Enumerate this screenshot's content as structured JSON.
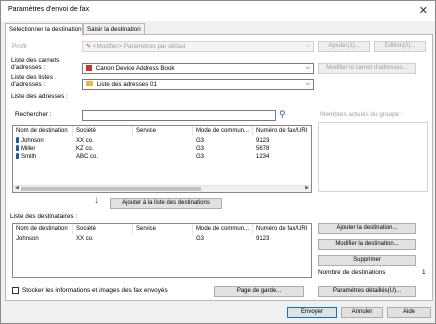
{
  "window": {
    "title": "Paramètres d'envoi de fax"
  },
  "tabs": [
    {
      "label": "Sélectionner la destination"
    },
    {
      "label": "Saisir la destination"
    }
  ],
  "profile": {
    "label": "Profil",
    "value": "<Modifier> Paramètres par défaut",
    "add_button": "Ajouter(1)...",
    "edit_button": "Édition(2)..."
  },
  "address_book": {
    "label": "Liste des carnets d'adresses :",
    "value": "Canon Device Address Book",
    "modify_button": "Modifier le carnet d'adresses..."
  },
  "address_lists": {
    "label": "Liste des listes d'adresses :",
    "value": "Liste des adresses 01"
  },
  "addresses_label": "Liste des adresses :",
  "search": {
    "label": "Rechercher :",
    "value": ""
  },
  "group_members_label": "Membres actuels du groupe :",
  "address_table": {
    "columns": [
      "Nom de destination",
      "Société",
      "Service",
      "Mode de commun...",
      "Numéro de fax/URI"
    ],
    "rows": [
      {
        "name": "Johnson",
        "company": "XX co.",
        "service": "",
        "mode": "G3",
        "number": "9123"
      },
      {
        "name": "Miller",
        "company": "KZ co.",
        "service": "",
        "mode": "G3",
        "number": "5678"
      },
      {
        "name": "Smith",
        "company": "ABC co.",
        "service": "",
        "mode": "G3",
        "number": "1234"
      }
    ]
  },
  "add_to_list_button": "Ajouter à la liste des destinations",
  "recipients": {
    "label": "Liste des destinataires :",
    "columns": [
      "Nom de destination",
      "Société",
      "Service",
      "Mode de commun...",
      "Numéro de fax/URI"
    ],
    "rows": [
      {
        "name": "Johnson",
        "company": "XX co.",
        "service": "",
        "mode": "G3",
        "number": "9123"
      }
    ]
  },
  "side_buttons": {
    "add_destination": "Ajouter la destination...",
    "modify_destination": "Modifier la destination...",
    "delete": "Supprimer"
  },
  "destination_count": {
    "label": "Nombre de destinations",
    "value": "1"
  },
  "store_checkbox": {
    "label": "Stocker les informations et images des fax envoyés",
    "checked": false
  },
  "cover_page_button": "Page de garde...",
  "detail_settings_button": "Paramètres détaillés(U)...",
  "footer": {
    "send": "Envoyer",
    "cancel": "Annuler",
    "help": "Aide"
  },
  "colors": {
    "accent": "#0078d7",
    "person_icon": "#1e56a0",
    "folder_icon": "#e8b84a",
    "pencil_icon": "#c0392b"
  }
}
